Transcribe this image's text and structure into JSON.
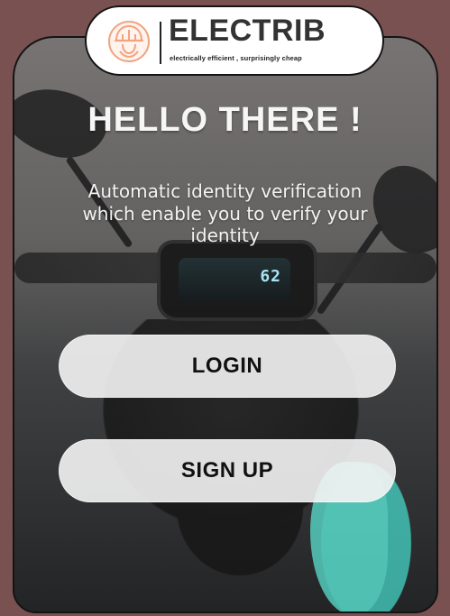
{
  "brand": {
    "name": "ELECTRIB",
    "tagline": "electrically efficient , surprisingly cheap",
    "logo_icon": "helmet-logo-icon"
  },
  "hero": {
    "title": "HELLO THERE !",
    "subtitle": "Automatic identity verification which enable you to verify your identity"
  },
  "background": {
    "dashboard_reading": "62"
  },
  "actions": {
    "login_label": "LOGIN",
    "signup_label": "SIGN UP"
  }
}
